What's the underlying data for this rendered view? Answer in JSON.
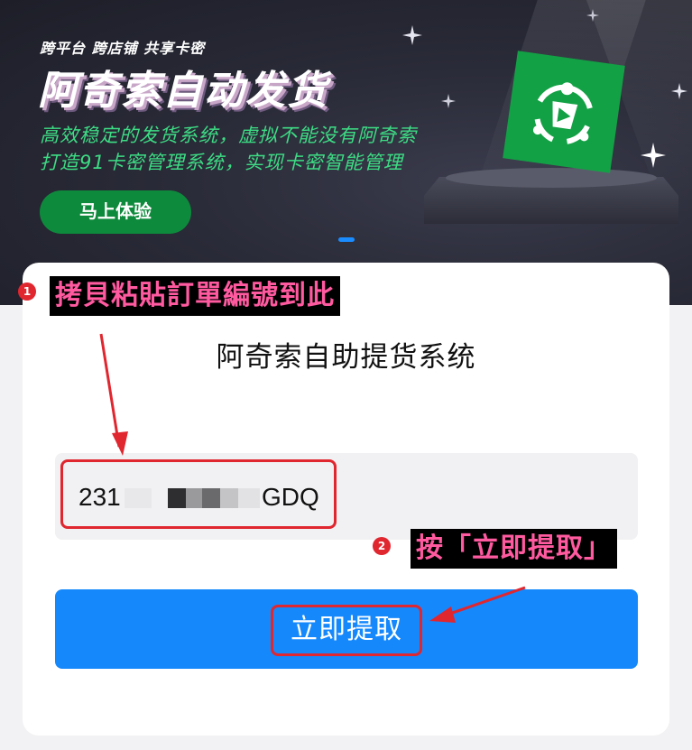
{
  "banner": {
    "tagline": "跨平台 跨店铺 共享卡密",
    "title": "阿奇索自动发货",
    "subtitle_1": "高效稳定的发货系统，虚拟不能没有阿奇索",
    "subtitle_2": "打造91卡密管理系统，实现卡密智能管理",
    "cta_label": "马上体验",
    "logo_icon": "green-robot-logo-icon",
    "accent_color": "#3ddc84",
    "cta_color": "#0e8a3c"
  },
  "card": {
    "title": "阿奇索自助提货系统",
    "order_value_prefix": "231",
    "order_value_suffix": "GDQ",
    "submit_label": "立即提取",
    "submit_color": "#1588fc"
  },
  "annotations": {
    "step1_number": "1",
    "step1_text": "拷貝粘貼訂單編號到此",
    "step2_number": "2",
    "step2_text": "按「立即提取」",
    "highlight_color": "#e0262f",
    "text_color": "#ff5aa0"
  }
}
